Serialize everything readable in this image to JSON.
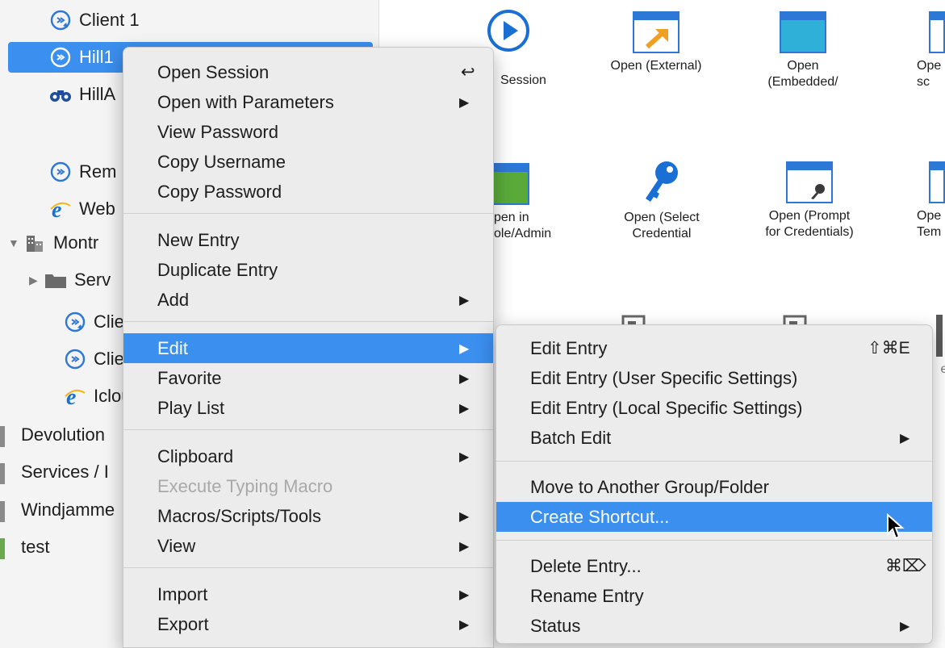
{
  "colors": {
    "accent": "#3b8fef",
    "icon_blue": "#2d78d6",
    "ie_blue": "#1a6fd4"
  },
  "sidebar": {
    "items": [
      {
        "label": "Client 1",
        "icon": "remote-desktop-icon"
      },
      {
        "label": "Hill1",
        "icon": "remote-desktop-icon"
      },
      {
        "label": "HillA",
        "icon": "binoculars-icon"
      },
      {
        "label": "Rem",
        "icon": "remote-desktop-icon"
      },
      {
        "label": "Web",
        "icon": "internet-explorer-icon"
      },
      {
        "label": "Montr",
        "icon": "building-icon"
      },
      {
        "label": "Serv",
        "icon": "folder-icon"
      },
      {
        "label": "Clie",
        "icon": "remote-desktop-icon"
      },
      {
        "label": "Clie",
        "icon": "remote-desktop-icon"
      },
      {
        "label": "Iclou",
        "icon": "internet-explorer-icon"
      },
      {
        "label": "Devolution"
      },
      {
        "label": "Services / I"
      },
      {
        "label": "Windjamme"
      },
      {
        "label": "test"
      }
    ]
  },
  "tiles": [
    {
      "label": "Session",
      "icon": "play-icon"
    },
    {
      "label": "Open (External)",
      "icon": "open-external-icon"
    },
    {
      "label": "Open\n(Embedded/",
      "icon": "open-embedded-icon"
    },
    {
      "label": "Ope\nsc",
      "icon": "window-icon"
    },
    {
      "label": "pen in\nole/Admin",
      "icon": "console-icon"
    },
    {
      "label": "Open (Select\nCredential",
      "icon": "key-icon"
    },
    {
      "label": "Open (Prompt\nfor Credentials)",
      "icon": "prompt-credentials-icon"
    },
    {
      "label": "Ope\nTem",
      "icon": "window-icon"
    },
    {
      "label": "e",
      "icon": "window-icon"
    }
  ],
  "context_menu": {
    "items": [
      {
        "label": "Open Session",
        "shortcut": "↩"
      },
      {
        "label": "Open with Parameters",
        "submenu": "▶"
      },
      {
        "label": "View Password"
      },
      {
        "label": "Copy Username"
      },
      {
        "label": "Copy Password"
      },
      {
        "label": "New Entry"
      },
      {
        "label": "Duplicate Entry"
      },
      {
        "label": "Add",
        "submenu": "▶"
      },
      {
        "label": "Edit",
        "submenu": "▶"
      },
      {
        "label": "Favorite",
        "submenu": "▶"
      },
      {
        "label": "Play List",
        "submenu": "▶"
      },
      {
        "label": "Clipboard",
        "submenu": "▶"
      },
      {
        "label": "Execute Typing Macro"
      },
      {
        "label": "Macros/Scripts/Tools",
        "submenu": "▶"
      },
      {
        "label": "View",
        "submenu": "▶"
      },
      {
        "label": "Import",
        "submenu": "▶"
      },
      {
        "label": "Export",
        "submenu": "▶"
      }
    ]
  },
  "edit_submenu": {
    "items": [
      {
        "label": "Edit Entry",
        "shortcut": "⇧⌘E"
      },
      {
        "label": "Edit Entry (User Specific Settings)"
      },
      {
        "label": "Edit Entry (Local Specific Settings)"
      },
      {
        "label": "Batch Edit",
        "submenu": "▶"
      },
      {
        "label": "Move to Another Group/Folder"
      },
      {
        "label": "Create Shortcut..."
      },
      {
        "label": "Delete Entry...",
        "shortcut": "⌘⌦"
      },
      {
        "label": "Rename Entry"
      },
      {
        "label": "Status",
        "submenu": "▶"
      }
    ]
  }
}
